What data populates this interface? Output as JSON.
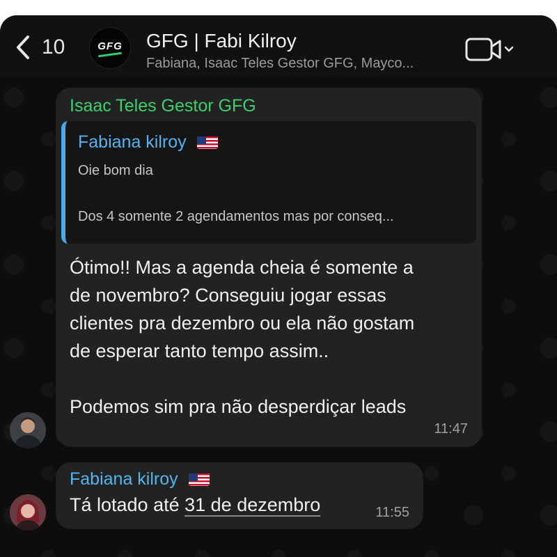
{
  "header": {
    "back_count": "10",
    "group_logo_text": "GFG",
    "title": "GFG | Fabi Kilroy",
    "subtitle": "Fabiana, Isaac Teles Gestor GFG, Mayco..."
  },
  "messages": [
    {
      "sender": "Isaac Teles Gestor GFG",
      "sender_color": "#3bd16f",
      "quote": {
        "sender": "Fabiana kilroy",
        "line1": "Oie bom dia",
        "line2": "Dos 4 somente 2 agendamentos mas por conseq..."
      },
      "lines": [
        "Ótimo!! Mas a agenda cheia é somente a",
        "de novembro? Conseguiu jogar essas",
        "clientes pra dezembro ou ela não gostam",
        "de esperar tanto tempo assim.."
      ],
      "line_last": "Podemos sim pra não desperdiçar leads",
      "time": "11:47"
    },
    {
      "sender": "Fabiana kilroy",
      "sender_color": "#55b4f0",
      "text_prefix": "Tá lotado até ",
      "text_link": "31 de dezembro",
      "time": "11:55"
    }
  ],
  "icons": [
    "chevron-left-icon",
    "video-camera-icon",
    "chevron-down-icon",
    "us-flag-icon"
  ]
}
